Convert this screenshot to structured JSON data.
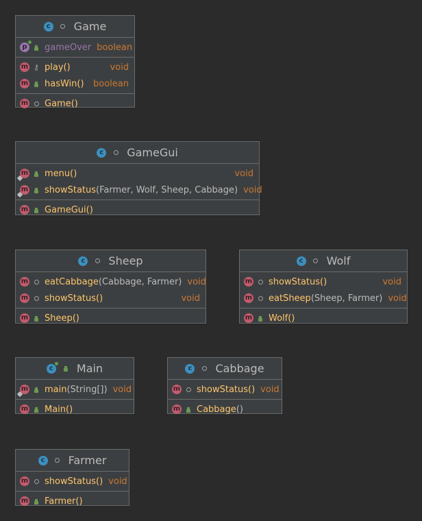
{
  "classes": {
    "game": {
      "name": "Game",
      "fields": [
        {
          "name": "gameOver",
          "type": "boolean"
        }
      ],
      "methods": [
        {
          "name": "play()",
          "ret": "void"
        },
        {
          "name": "hasWin()",
          "ret": "boolean"
        }
      ],
      "constructors": [
        {
          "name": "Game()"
        }
      ]
    },
    "gamegui": {
      "name": "GameGui",
      "methods": [
        {
          "name": "menu()",
          "ret": "void"
        },
        {
          "name": "showStatus",
          "params": "(Farmer, Wolf, Sheep, Cabbage)",
          "ret": "void"
        }
      ],
      "constructors": [
        {
          "name": "GameGui()"
        }
      ]
    },
    "sheep": {
      "name": "Sheep",
      "methods": [
        {
          "name": "eatCabbage",
          "params": "(Cabbage, Farmer)",
          "ret": "void"
        },
        {
          "name": "showStatus()",
          "ret": "void"
        }
      ],
      "constructors": [
        {
          "name": "Sheep()"
        }
      ]
    },
    "wolf": {
      "name": "Wolf",
      "methods": [
        {
          "name": "showStatus()",
          "ret": "void"
        },
        {
          "name": "eatSheep",
          "params": "(Sheep, Farmer)",
          "ret": "void"
        }
      ],
      "constructors": [
        {
          "name": "Wolf()"
        }
      ]
    },
    "main": {
      "name": "Main",
      "methods": [
        {
          "name": "main",
          "params": "(String[])",
          "ret": "void"
        }
      ],
      "constructors": [
        {
          "name": "Main()"
        }
      ]
    },
    "cabbage": {
      "name": "Cabbage",
      "methods": [
        {
          "name": "showStatus()",
          "ret": "void"
        }
      ],
      "constructors": [
        {
          "name": "Cabbage",
          "params": "()"
        }
      ]
    },
    "farmer": {
      "name": "Farmer",
      "methods": [
        {
          "name": "showStatus()",
          "ret": "void"
        }
      ],
      "constructors": [
        {
          "name": "Farmer()"
        }
      ]
    }
  },
  "badges": {
    "class": "c",
    "method": "m",
    "field": "p"
  },
  "colors": {
    "background": "#2b2b2b",
    "box": "#3c3f41",
    "border": "#6b6b6b",
    "method_name": "#ffc66d",
    "field_name": "#9876aa",
    "type": "#cc7832",
    "text": "#bbbbbb",
    "class_badge": "#3d8fbe",
    "method_badge": "#c25b6e",
    "field_badge": "#9876aa"
  }
}
